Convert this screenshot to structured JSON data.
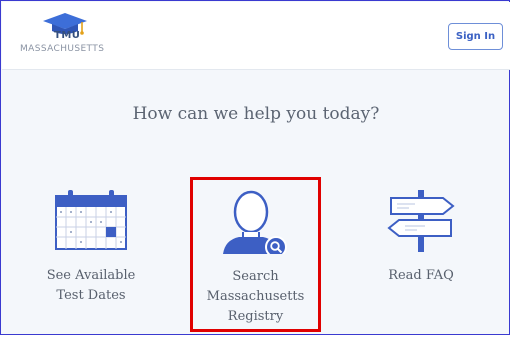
{
  "header": {
    "logo": {
      "abbr": "TMU",
      "region": "MASSACHUSETTS"
    },
    "signin_label": "Sign In"
  },
  "main": {
    "headline": "How can we help you today?",
    "options": [
      {
        "label_lines": [
          "See Available",
          "Test Dates"
        ],
        "icon": "calendar-icon",
        "highlighted": false
      },
      {
        "label_lines": [
          "Search",
          "Massachusetts",
          "Registry"
        ],
        "icon": "person-search-icon",
        "highlighted": true
      },
      {
        "label_lines": [
          "Read FAQ"
        ],
        "icon": "signpost-icon",
        "highlighted": false
      }
    ]
  },
  "colors": {
    "accent": "#3c62c4",
    "highlight_border": "#e00000",
    "icon_fill": "#3d5fc4",
    "page_bg": "#f4f7fb"
  }
}
